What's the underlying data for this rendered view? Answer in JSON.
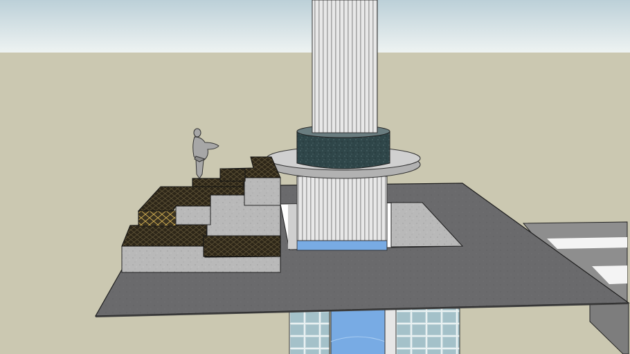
{
  "app": {
    "view": "3d-model-viewport"
  },
  "scene": {
    "colors": {
      "sky_top": "#bcd0d8",
      "sky_bottom": "#eef3f2",
      "ground": "#cbc8b1",
      "slab": "#6b6b6d",
      "slab_side": "#59595b",
      "column": "#e4e4e4",
      "column_flute": "#a8a8a8",
      "granite_ring": "#2d4447",
      "disc": "#c8c8c8",
      "water": "#7aaee6",
      "glass": "#b8cfd6",
      "concrete": "#b5b5b5",
      "stair_top": "#2b2517",
      "outline": "#1e1e1e"
    },
    "icons": [
      "human-figure-icon"
    ]
  }
}
